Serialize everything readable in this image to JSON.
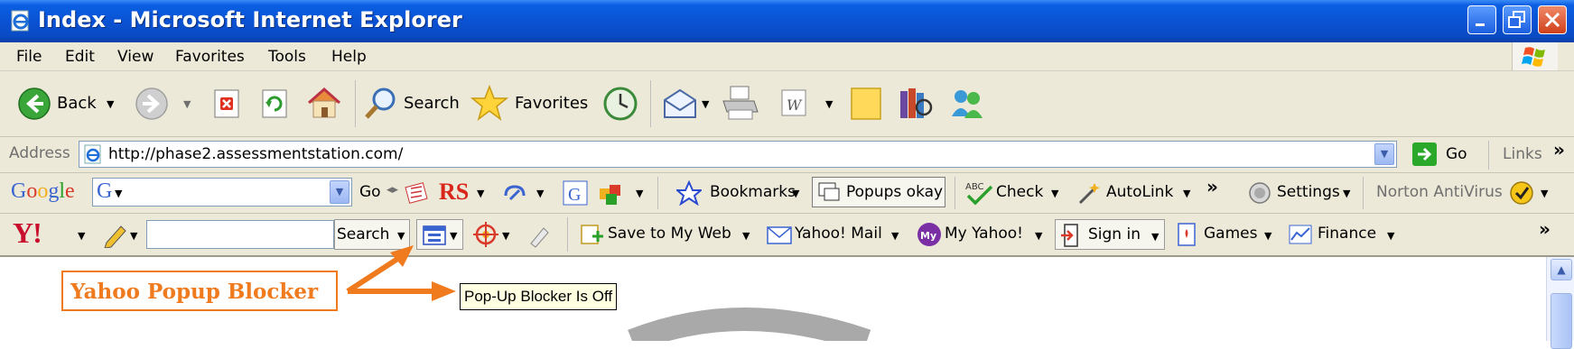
{
  "window": {
    "title": "Index - Microsoft Internet Explorer"
  },
  "menu": [
    "File",
    "Edit",
    "View",
    "Favorites",
    "Tools",
    "Help"
  ],
  "toolbar": {
    "back_label": "Back",
    "search_label": "Search",
    "favorites_label": "Favorites"
  },
  "address": {
    "label": "Address",
    "url": "http://phase2.assessmentstation.com/",
    "go_label": "Go",
    "links_label": "Links"
  },
  "google": {
    "logo": "Google",
    "go_label": "Go",
    "rs_label": "RS",
    "bookmarks_label": "Bookmarks",
    "popups_label": "Popups okay",
    "check_label": "Check",
    "autolink_label": "AutoLink",
    "settings_label": "Settings",
    "norton_label": "Norton AntiVirus",
    "overflow": "»"
  },
  "yahoo": {
    "logo": "Y!",
    "search_label": "Search",
    "save_label": "Save to My Web",
    "mail_label": "Yahoo! Mail",
    "myyahoo_label": "My Yahoo!",
    "signin_label": "Sign in",
    "games_label": "Games",
    "finance_label": "Finance",
    "overflow": "»"
  },
  "annotation": {
    "callout": "Yahoo Popup Blocker",
    "tooltip": "Pop-Up Blocker Is Off"
  },
  "colors": {
    "title_bar": "#0a52d3",
    "chrome": "#ece9d8",
    "callout": "#f07a1e",
    "tooltip_bg": "#ffffe1"
  }
}
